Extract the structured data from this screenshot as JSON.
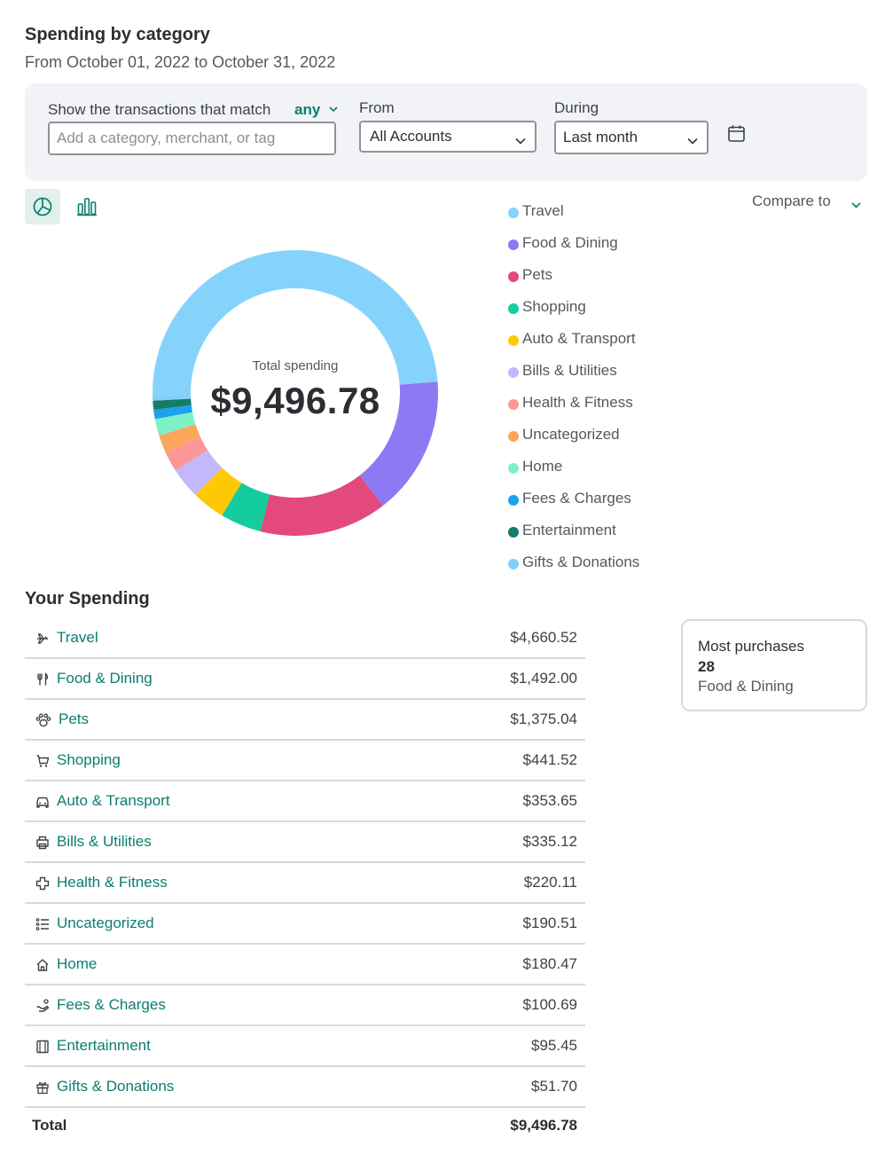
{
  "header": {
    "title": "Spending by category",
    "subtitle": "From October 01, 2022 to October 31, 2022"
  },
  "filters": {
    "match_label": "Show the transactions that match",
    "match_value": "any",
    "search_placeholder": "Add a category, merchant, or tag",
    "from_label": "From",
    "from_value": "All Accounts",
    "during_label": "During",
    "during_value": "Last month"
  },
  "view": {
    "active": "pie",
    "compare_label": "Compare to"
  },
  "total": {
    "label": "Total spending",
    "value": "$9,496.78"
  },
  "chart_data": {
    "type": "pie",
    "variant": "donut",
    "center_label": "Total spending",
    "center_value": "$9,496.78",
    "legend_position": "right",
    "categories": [
      "Travel",
      "Food & Dining",
      "Pets",
      "Shopping",
      "Auto & Transport",
      "Bills & Utilities",
      "Health & Fitness",
      "Uncategorized",
      "Home",
      "Fees & Charges",
      "Entertainment",
      "Gifts & Donations"
    ],
    "values": [
      4660.52,
      1492.0,
      1375.04,
      441.52,
      353.65,
      335.12,
      220.11,
      190.51,
      180.47,
      100.69,
      95.45,
      51.7
    ],
    "colors": [
      "#85d3fb",
      "#8e79f5",
      "#e3497c",
      "#14cc9e",
      "#fdc905",
      "#c4b7fb",
      "#fc9797",
      "#fba65b",
      "#7ff0c5",
      "#1ca2ec",
      "#157c6c",
      "#84cdf7"
    ]
  },
  "legend": [
    {
      "label": "Travel",
      "color": "#85d3fb"
    },
    {
      "label": "Food & Dining",
      "color": "#8e79f5"
    },
    {
      "label": "Pets",
      "color": "#e3497c"
    },
    {
      "label": "Shopping",
      "color": "#14cc9e"
    },
    {
      "label": "Auto & Transport",
      "color": "#fdc905"
    },
    {
      "label": "Bills & Utilities",
      "color": "#c4b7fb"
    },
    {
      "label": "Health & Fitness",
      "color": "#fc9797"
    },
    {
      "label": "Uncategorized",
      "color": "#fba65b"
    },
    {
      "label": "Home",
      "color": "#7ff0c5"
    },
    {
      "label": "Fees & Charges",
      "color": "#1ca2ec"
    },
    {
      "label": "Entertainment",
      "color": "#157c6c"
    },
    {
      "label": "Gifts & Donations",
      "color": "#84cdf7"
    }
  ],
  "spending": {
    "heading": "Your Spending",
    "rows": [
      {
        "icon": "plane-icon",
        "name": "Travel",
        "amount": "$4,660.52"
      },
      {
        "icon": "fork-knife-icon",
        "name": "Food & Dining",
        "amount": "$1,492.00"
      },
      {
        "icon": "paw-icon",
        "name": "Pets",
        "amount": "$1,375.04"
      },
      {
        "icon": "cart-icon",
        "name": "Shopping",
        "amount": "$441.52"
      },
      {
        "icon": "car-icon",
        "name": "Auto & Transport",
        "amount": "$353.65"
      },
      {
        "icon": "printer-icon",
        "name": "Bills & Utilities",
        "amount": "$335.12"
      },
      {
        "icon": "health-cross-icon",
        "name": "Health & Fitness",
        "amount": "$220.11"
      },
      {
        "icon": "list-icon",
        "name": "Uncategorized",
        "amount": "$190.51"
      },
      {
        "icon": "house-icon",
        "name": "Home",
        "amount": "$180.47"
      },
      {
        "icon": "fee-hand-icon",
        "name": "Fees & Charges",
        "amount": "$100.69"
      },
      {
        "icon": "film-icon",
        "name": "Entertainment",
        "amount": "$95.45"
      },
      {
        "icon": "gift-icon",
        "name": "Gifts & Donations",
        "amount": "$51.70"
      }
    ],
    "total_label": "Total",
    "total_amount": "$9,496.78"
  },
  "most_purchases": {
    "title": "Most purchases",
    "count": "28",
    "category": "Food & Dining"
  }
}
